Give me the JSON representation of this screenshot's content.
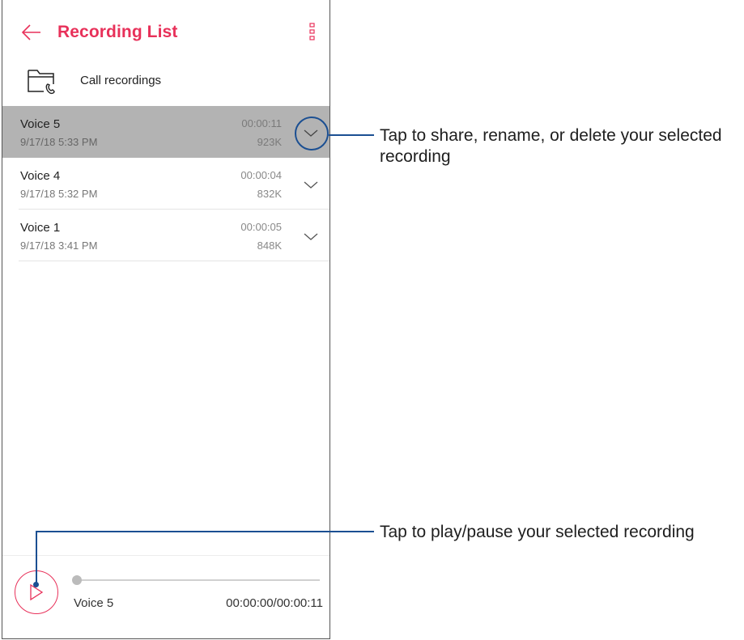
{
  "app": {
    "title": "Recording List",
    "accent_color": "#e8315a",
    "back_icon": "arrow-left-icon",
    "menu_icon": "more-vertical-icon"
  },
  "call_recordings": {
    "label": "Call recordings",
    "icon": "folder-phone-icon"
  },
  "recordings": [
    {
      "name": "Voice 5",
      "date": "9/17/18 5:33 PM",
      "duration": "00:00:11",
      "size": "923K",
      "selected": true
    },
    {
      "name": "Voice 4",
      "date": "9/17/18 5:32 PM",
      "duration": "00:00:04",
      "size": "832K",
      "selected": false
    },
    {
      "name": "Voice 1",
      "date": "9/17/18 3:41 PM",
      "duration": "00:00:05",
      "size": "848K",
      "selected": false
    }
  ],
  "player": {
    "track_name": "Voice 5",
    "time": "00:00:00/00:00:11",
    "progress": 0,
    "play_icon": "play-icon"
  },
  "callouts": {
    "expand": "Tap to share, rename, or delete your selected recording",
    "expand_line1": "Tap to share, rename, or delete your selected",
    "expand_line2": "recording",
    "play": "Tap to play/pause your selected recording",
    "color": "#1b4f92"
  }
}
